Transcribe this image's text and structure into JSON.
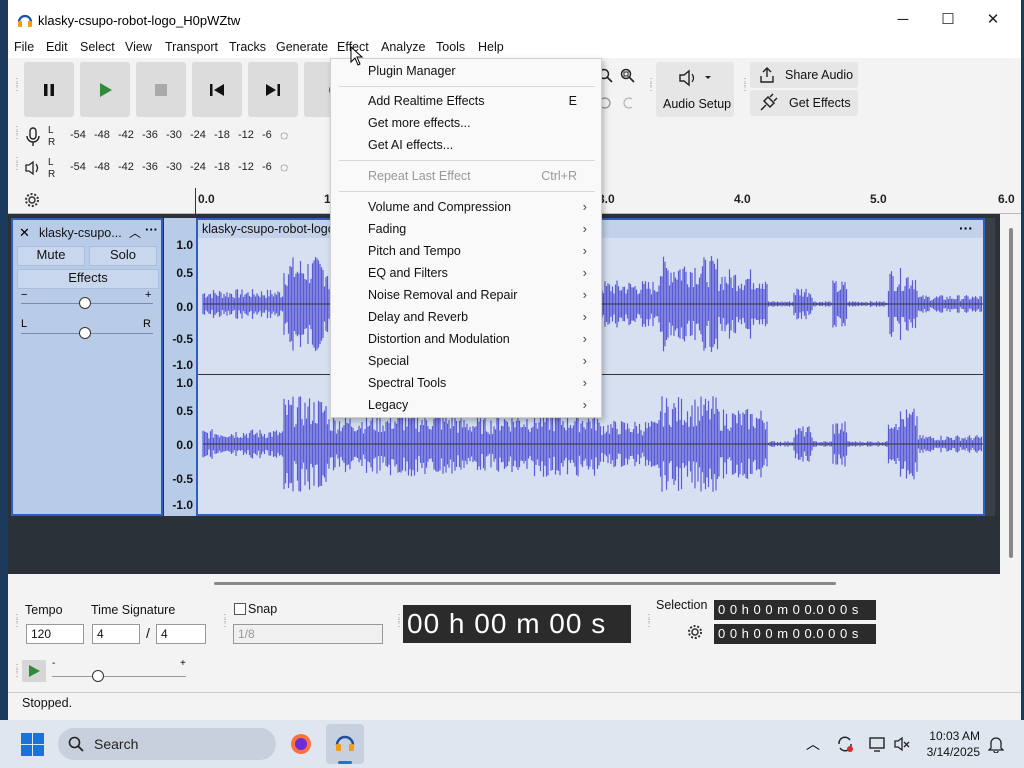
{
  "window": {
    "title": "klasky-csupo-robot-logo_H0pWZtw",
    "minimize": "─",
    "maximize": "☐",
    "close": "✕"
  },
  "menubar": {
    "items": [
      "File",
      "Edit",
      "Select",
      "View",
      "Transport",
      "Tracks",
      "Generate",
      "Effect",
      "Analyze",
      "Tools",
      "Help"
    ]
  },
  "meters": {
    "record_scale": [
      "-54",
      "-48",
      "-42",
      "-36",
      "-30",
      "-24",
      "-18",
      "-12",
      "-6"
    ],
    "play_scale": [
      "-54",
      "-48",
      "-42",
      "-36",
      "-30",
      "-24",
      "-18",
      "-12",
      "-6"
    ],
    "lr": [
      "L",
      "R"
    ]
  },
  "toolbar": {
    "audio_setup": "Audio Setup",
    "share_audio": "Share Audio",
    "get_effects": "Get Effects"
  },
  "ruler": {
    "ticks": [
      "0.0",
      "1",
      "3.0",
      "4.0",
      "5.0",
      "6.0"
    ]
  },
  "track": {
    "name": "klasky-csupo...",
    "mute": "Mute",
    "solo": "Solo",
    "effects": "Effects",
    "gain_minus": "−",
    "gain_plus": "+",
    "pan_left": "L",
    "pan_right": "R",
    "clip_name": "klasky-csupo-robot-logo",
    "scale_top": [
      "1.0",
      "0.5",
      "0.0",
      "-0.5",
      "-1.0"
    ],
    "scale_bottom": [
      "1.0",
      "0.5",
      "0.0",
      "-0.5",
      "-1.0"
    ]
  },
  "effect_menu": {
    "plugin_manager": "Plugin Manager",
    "add_realtime": "Add Realtime Effects",
    "add_realtime_shortcut": "E",
    "get_more": "Get more effects...",
    "get_ai": "Get AI effects...",
    "repeat_last": "Repeat Last Effect",
    "repeat_last_shortcut": "Ctrl+R",
    "submenus": [
      "Volume and Compression",
      "Fading",
      "Pitch and Tempo",
      "EQ and Filters",
      "Noise Removal and Repair",
      "Delay and Reverb",
      "Distortion and Modulation",
      "Special",
      "Spectral Tools",
      "Legacy"
    ]
  },
  "bottom": {
    "tempo_label": "Tempo",
    "tempo_value": "120",
    "timesig_label": "Time Signature",
    "timesig_num": "4",
    "timesig_slash": "/",
    "timesig_den": "4",
    "snap_label": "Snap",
    "snap_value": "1/8",
    "time_display": "00 h 00 m 00 s",
    "selection_label": "Selection",
    "sel_start": "0 0 h 0 0 m 0 0.0 0 0 s",
    "sel_end": "0 0 h 0 0 m 0 0.0 0 0 s",
    "speed_minus": "-",
    "speed_plus": "+"
  },
  "status": {
    "text": "Stopped."
  },
  "taskbar": {
    "search_placeholder": "Search",
    "time": "10:03 AM",
    "date": "3/14/2025"
  },
  "colors": {
    "waveform": "#5b5bd6",
    "track_bg": "#d6e0f0",
    "selection_border": "#2e5ebf"
  }
}
